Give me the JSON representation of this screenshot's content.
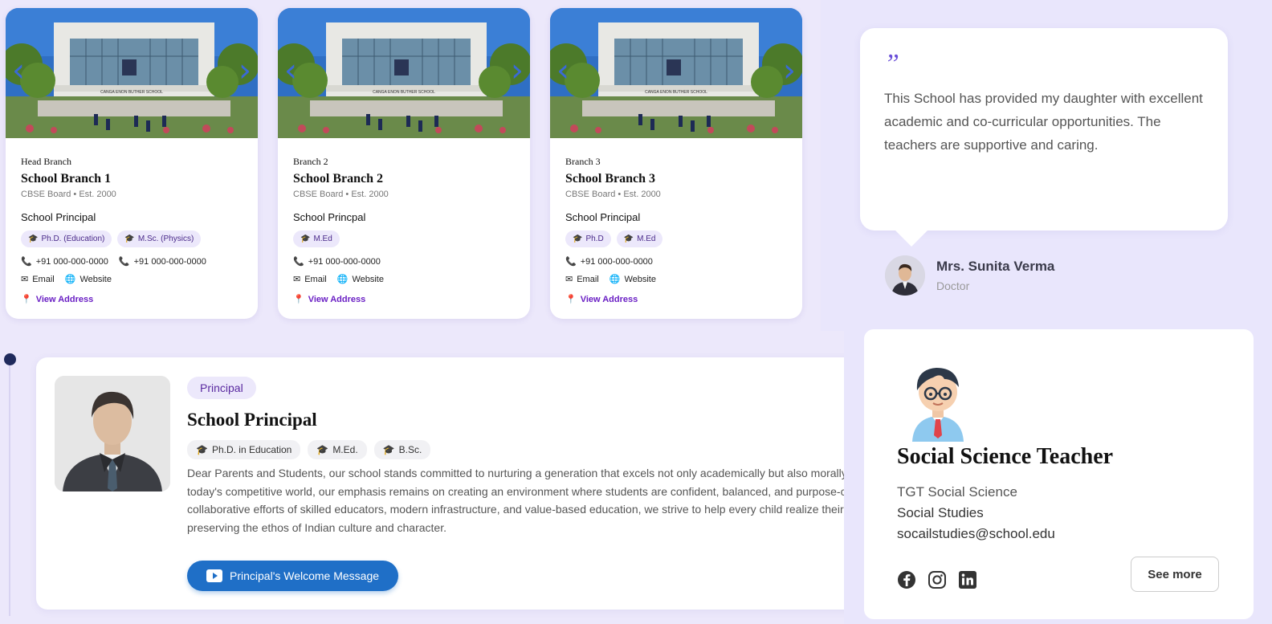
{
  "branches": [
    {
      "tag": "Head Branch",
      "name": "School Branch 1",
      "meta": "CBSE Board • Est. 2000",
      "role": "School Principal",
      "quals": [
        "Ph.D. (Education)",
        "M.Sc. (Physics)"
      ],
      "phones": [
        "+91 000-000-0000",
        "+91 000-000-0000"
      ],
      "email_label": "Email",
      "website_label": "Website",
      "address_label": "View Address",
      "sign_text": "CANGA ENON BUTHER SCHOOL"
    },
    {
      "tag": "Branch 2",
      "name": "School Branch 2",
      "meta": "CBSE Board • Est. 2000",
      "role": "School Princpal",
      "quals": [
        "M.Ed"
      ],
      "phones": [
        "+91 000-000-0000"
      ],
      "email_label": "Email",
      "website_label": "Website",
      "address_label": "View Address",
      "sign_text": "CANGA ENON BUTHER SCHOOL"
    },
    {
      "tag": "Branch 3",
      "name": "School Branch 3",
      "meta": "CBSE Board • Est. 2000",
      "role": "School Principal",
      "quals": [
        "Ph.D",
        "M.Ed"
      ],
      "phones": [
        "+91 000-000-0000"
      ],
      "email_label": "Email",
      "website_label": "Website",
      "address_label": "View Address",
      "sign_text": "CANGA ENON BUTHER SCHOOL"
    }
  ],
  "testimonial": {
    "quote_mark": "”",
    "text": "This School has provided my daughter with excellent academic and co-curricular opportunities. The teachers are supportive and caring.",
    "author_name": "Mrs. Sunita Verma",
    "author_role": "Doctor"
  },
  "principal": {
    "badge": "Principal",
    "name": "School Principal",
    "quals": [
      "Ph.D. in Education",
      "M.Ed.",
      "B.Sc."
    ],
    "message_lines": [
      "Dear Parents and Students, our school stands committed to nurturing a generation that excels not only academically but also morally",
      "today's competitive world, our emphasis remains on creating an environment where students are confident, balanced, and purpose-c",
      "collaborative efforts of skilled educators, modern infrastructure, and value-based education, we strive to help every child realize their",
      "preserving the ethos of Indian culture and character."
    ],
    "button_label": "Principal's Welcome Message"
  },
  "teacher": {
    "title": "Social Science Teacher",
    "designation": "TGT Social Science",
    "subject": "Social Studies",
    "email": "socailstudies@school.edu",
    "see_more_label": "See more",
    "social": [
      "facebook-icon",
      "instagram-icon",
      "linkedin-icon"
    ]
  },
  "colors": {
    "background": "#e9e6fc",
    "accent_purple": "#6a1fc4",
    "button_blue": "#1f6fc7",
    "chip_bg": "#ece8fb"
  }
}
